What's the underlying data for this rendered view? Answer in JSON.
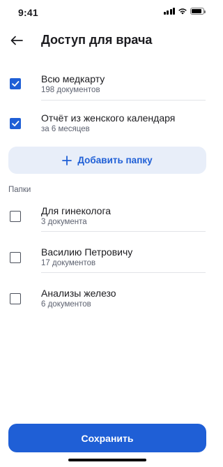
{
  "status_bar": {
    "time": "9:41",
    "battery_level": 0.9
  },
  "header": {
    "title": "Доступ для врача",
    "back_icon": "arrow-left-icon"
  },
  "access_items": [
    {
      "title": "Всю медкарту",
      "subtitle": "198 документов",
      "checked": true
    },
    {
      "title": "Отчёт из женского календаря",
      "subtitle": "за 6 месяцев",
      "checked": true
    }
  ],
  "add_folder": {
    "label": "Добавить папку",
    "icon": "plus-icon"
  },
  "folders_section": {
    "label": "Папки",
    "items": [
      {
        "title": "Для гинеколога",
        "subtitle": "3 документа",
        "checked": false
      },
      {
        "title": "Василию Петровичу",
        "subtitle": "17 документов",
        "checked": false
      },
      {
        "title": "Анализы железо",
        "subtitle": "6 документов",
        "checked": false
      }
    ]
  },
  "footer": {
    "save_label": "Сохранить"
  },
  "colors": {
    "accent": "#1f5fd6",
    "accent_light": "#e8eef9",
    "text": "#1b1b1f",
    "secondary_text": "#5d6270",
    "divider": "#e1e3e8"
  }
}
